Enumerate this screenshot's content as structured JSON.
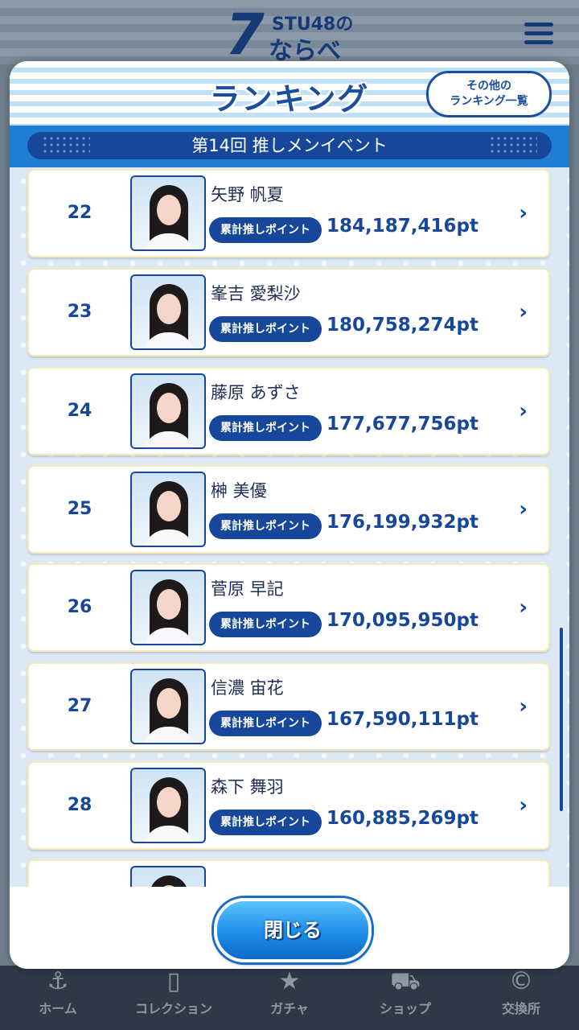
{
  "app": {
    "logo_top": "STU48の",
    "logo_seven": "7",
    "logo_bottom": "ならべ"
  },
  "modal": {
    "title": "ランキング",
    "other_button_line1": "その他の",
    "other_button_line2": "ランキング一覧",
    "event_title": "第14回 推しメンイベント",
    "badge_label": "累計推しポイント",
    "close_label": "閉じる"
  },
  "ranking": [
    {
      "rank": "22",
      "name": "矢野 帆夏",
      "points": "184,187,416pt"
    },
    {
      "rank": "23",
      "name": "峯吉 愛梨沙",
      "points": "180,758,274pt"
    },
    {
      "rank": "24",
      "name": "藤原 あずさ",
      "points": "177,677,756pt"
    },
    {
      "rank": "25",
      "name": "榊 美優",
      "points": "176,199,932pt"
    },
    {
      "rank": "26",
      "name": "菅原 早記",
      "points": "170,095,950pt"
    },
    {
      "rank": "27",
      "name": "信濃 宙花",
      "points": "167,590,111pt"
    },
    {
      "rank": "28",
      "name": "森下 舞羽",
      "points": "160,885,269pt"
    }
  ],
  "bottom_nav": [
    {
      "label": "ホーム",
      "icon": "anchor-icon"
    },
    {
      "label": "コレクション",
      "icon": "cards-icon"
    },
    {
      "label": "ガチャ",
      "icon": "gacha-icon"
    },
    {
      "label": "ショップ",
      "icon": "cart-icon"
    },
    {
      "label": "交換所",
      "icon": "exchange-icon"
    }
  ],
  "colors": {
    "primary": "#17479a",
    "accent": "#1f7ed4"
  }
}
